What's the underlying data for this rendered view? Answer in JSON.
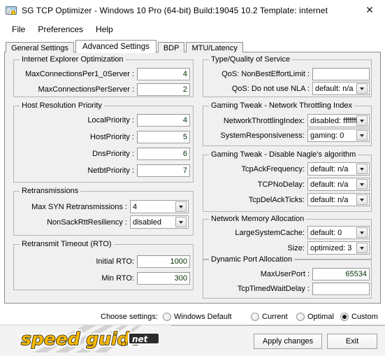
{
  "window": {
    "title": "SG TCP Optimizer - Windows 10 Pro (64-bit) Build:19045 10.2  Template: internet",
    "icon": "app-icon",
    "close_label": "✕"
  },
  "menu": {
    "items": [
      {
        "label": "File"
      },
      {
        "label": "Preferences"
      },
      {
        "label": "Help"
      }
    ]
  },
  "tabs": [
    {
      "label": "General Settings",
      "active": false
    },
    {
      "label": "Advanced Settings",
      "active": true
    },
    {
      "label": "BDP",
      "active": false
    },
    {
      "label": "MTU/Latency",
      "active": false
    }
  ],
  "groups": {
    "ie_optimization": {
      "title": "Internet Explorer Optimization",
      "fields": [
        {
          "label": "MaxConnectionsPer1_0Server :",
          "value": "4",
          "type": "text"
        },
        {
          "label": "MaxConnectionsPerServer :",
          "value": "2",
          "type": "text"
        }
      ]
    },
    "host_resolution": {
      "title": "Host Resolution Priority",
      "fields": [
        {
          "label": "LocalPriority :",
          "value": "4",
          "type": "text"
        },
        {
          "label": "HostPriority :",
          "value": "5",
          "type": "text"
        },
        {
          "label": "DnsPriority :",
          "value": "6",
          "type": "text"
        },
        {
          "label": "NetbtPriority :",
          "value": "7",
          "type": "text"
        }
      ]
    },
    "retransmissions": {
      "title": "Retransmissions",
      "fields": [
        {
          "label": "Max SYN Retransmissions :",
          "value": "4",
          "type": "select"
        },
        {
          "label": "NonSackRttResiliency :",
          "value": "disabled",
          "type": "select"
        }
      ]
    },
    "rto": {
      "title": "Retransmit Timeout (RTO)",
      "fields": [
        {
          "label": "Initial RTO:",
          "value": "1000",
          "type": "text"
        },
        {
          "label": "Min RTO:",
          "value": "300",
          "type": "text"
        }
      ]
    },
    "qos": {
      "title": "Type/Quality of Service",
      "fields": [
        {
          "label": "QoS: NonBestEffortLimit :",
          "value": "",
          "type": "text"
        },
        {
          "label": "QoS: Do not use NLA :",
          "value": "default: n/a",
          "type": "select"
        }
      ]
    },
    "throttling": {
      "title": "Gaming Tweak - Network Throttling Index",
      "fields": [
        {
          "label": "NetworkThrottlingIndex:",
          "value": "disabled: ffffffff",
          "type": "select"
        },
        {
          "label": "SystemResponsiveness:",
          "value": "gaming: 0",
          "type": "select"
        }
      ]
    },
    "nagle": {
      "title": "Gaming Tweak - Disable Nagle's algorithm",
      "fields": [
        {
          "label": "TcpAckFrequency:",
          "value": "default: n/a",
          "type": "select"
        },
        {
          "label": "TCPNoDelay:",
          "value": "default: n/a",
          "type": "select"
        },
        {
          "label": "TcpDelAckTicks:",
          "value": "default: n/a",
          "type": "select"
        }
      ]
    },
    "memory": {
      "title": "Network Memory Allocation",
      "fields": [
        {
          "label": "LargeSystemCache:",
          "value": "default: 0",
          "type": "select"
        },
        {
          "label": "Size:",
          "value": "optimized: 3",
          "type": "select"
        }
      ]
    },
    "dynamic_port": {
      "title": "Dynamic Port Allocation",
      "fields": [
        {
          "label": "MaxUserPort :",
          "value": "65534",
          "type": "text"
        },
        {
          "label": "TcpTimedWaitDelay :",
          "value": "",
          "type": "text"
        }
      ]
    }
  },
  "choose_settings": {
    "label": "Choose settings:",
    "options": [
      {
        "label": "Windows Default",
        "selected": false
      },
      {
        "label": "Current",
        "selected": false
      },
      {
        "label": "Optimal",
        "selected": false
      },
      {
        "label": "Custom",
        "selected": true
      }
    ]
  },
  "footer": {
    "logo_text_1": "speed",
    "logo_text_2": "guide",
    "logo_dot": ".",
    "logo_net": "net",
    "apply_label": "Apply changes",
    "exit_label": "Exit"
  },
  "colors": {
    "accent_yellow": "#f5b800",
    "panel_bg": "#f0f0f0",
    "group_border": "#b4b4b4"
  }
}
